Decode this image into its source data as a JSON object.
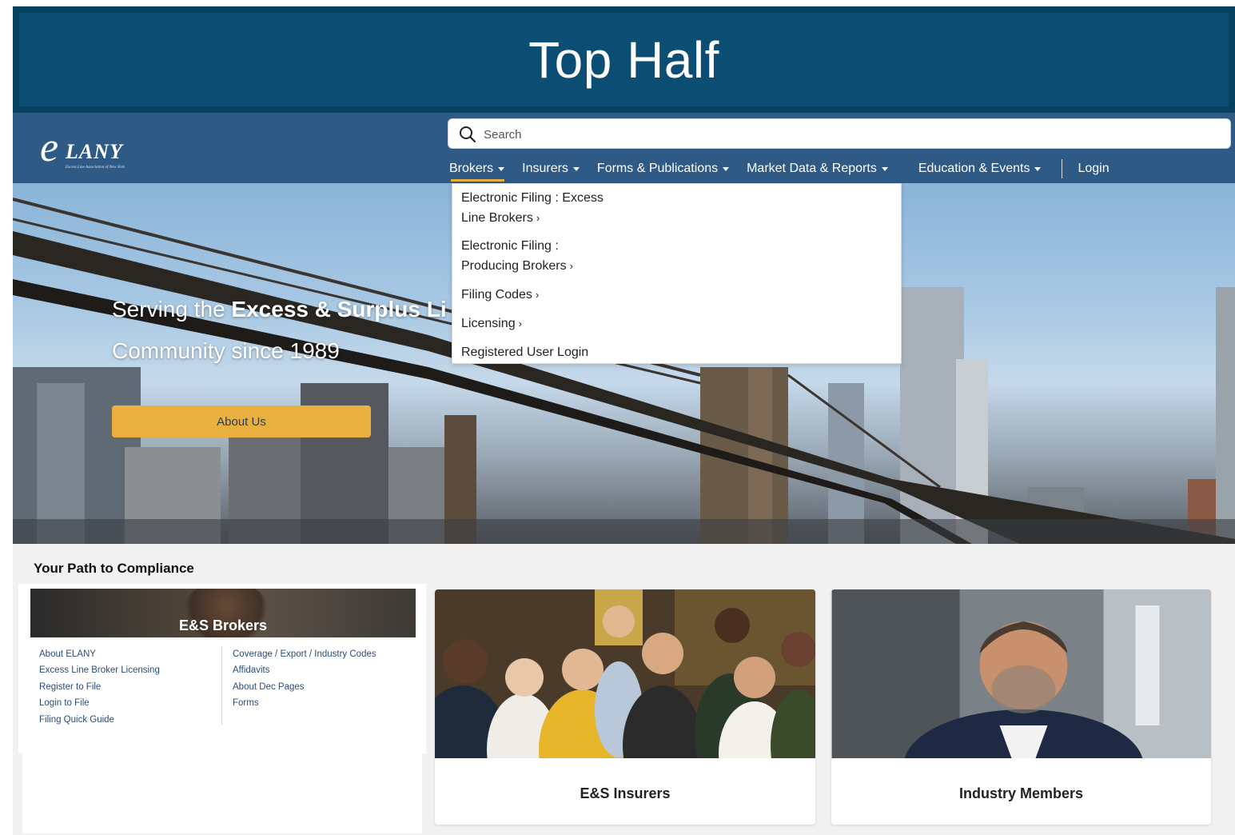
{
  "banner": {
    "title": "Top Half"
  },
  "header": {
    "logo_mark": "e",
    "logo_text": "LANY",
    "logo_subtitle": "Excess Line Association of New York",
    "search_placeholder": "Search",
    "nav": [
      {
        "label": "Brokers",
        "has_caret": true,
        "active": true
      },
      {
        "label": "Insurers",
        "has_caret": true
      },
      {
        "label": "Forms & Publications",
        "has_caret": true
      },
      {
        "label": "Market Data & Reports",
        "has_caret": true
      },
      {
        "label": "Education & Events",
        "has_caret": true
      },
      {
        "label": "Login",
        "has_caret": false
      }
    ]
  },
  "dropdown": {
    "items": [
      {
        "line1": "Electronic Filing : Excess",
        "line2": "Line Brokers",
        "chevron": "›"
      },
      {
        "line1": "Electronic Filing :",
        "line2": "Producing Brokers",
        "chevron": "›"
      },
      {
        "line1": "Filing Codes",
        "chevron": "›"
      },
      {
        "line1": "Licensing",
        "chevron": "›"
      },
      {
        "line1": "Registered User Login"
      }
    ]
  },
  "hero": {
    "line1_prefix": "Serving the ",
    "line1_bold": "Excess & Surplus Li",
    "line2": "Community since 1989",
    "about_button": "About Us"
  },
  "compliance": {
    "title": "Your Path to Compliance",
    "brokers_card": {
      "title": "E&S Brokers",
      "left_links": [
        "About ELANY",
        "Excess Line Broker Licensing",
        "Register to File",
        "Login to File",
        "Filing Quick Guide"
      ],
      "right_links": [
        "Coverage / Export / Industry Codes",
        "Affidavits",
        "About Dec Pages",
        "Forms"
      ]
    },
    "insurers_card": {
      "title": "E&S Insurers"
    },
    "members_card": {
      "title": "Industry Members"
    }
  },
  "colors": {
    "banner": "#0c4e73",
    "header": "#2f5a85",
    "accent": "#e9b03f",
    "link": "#2a4d78"
  }
}
